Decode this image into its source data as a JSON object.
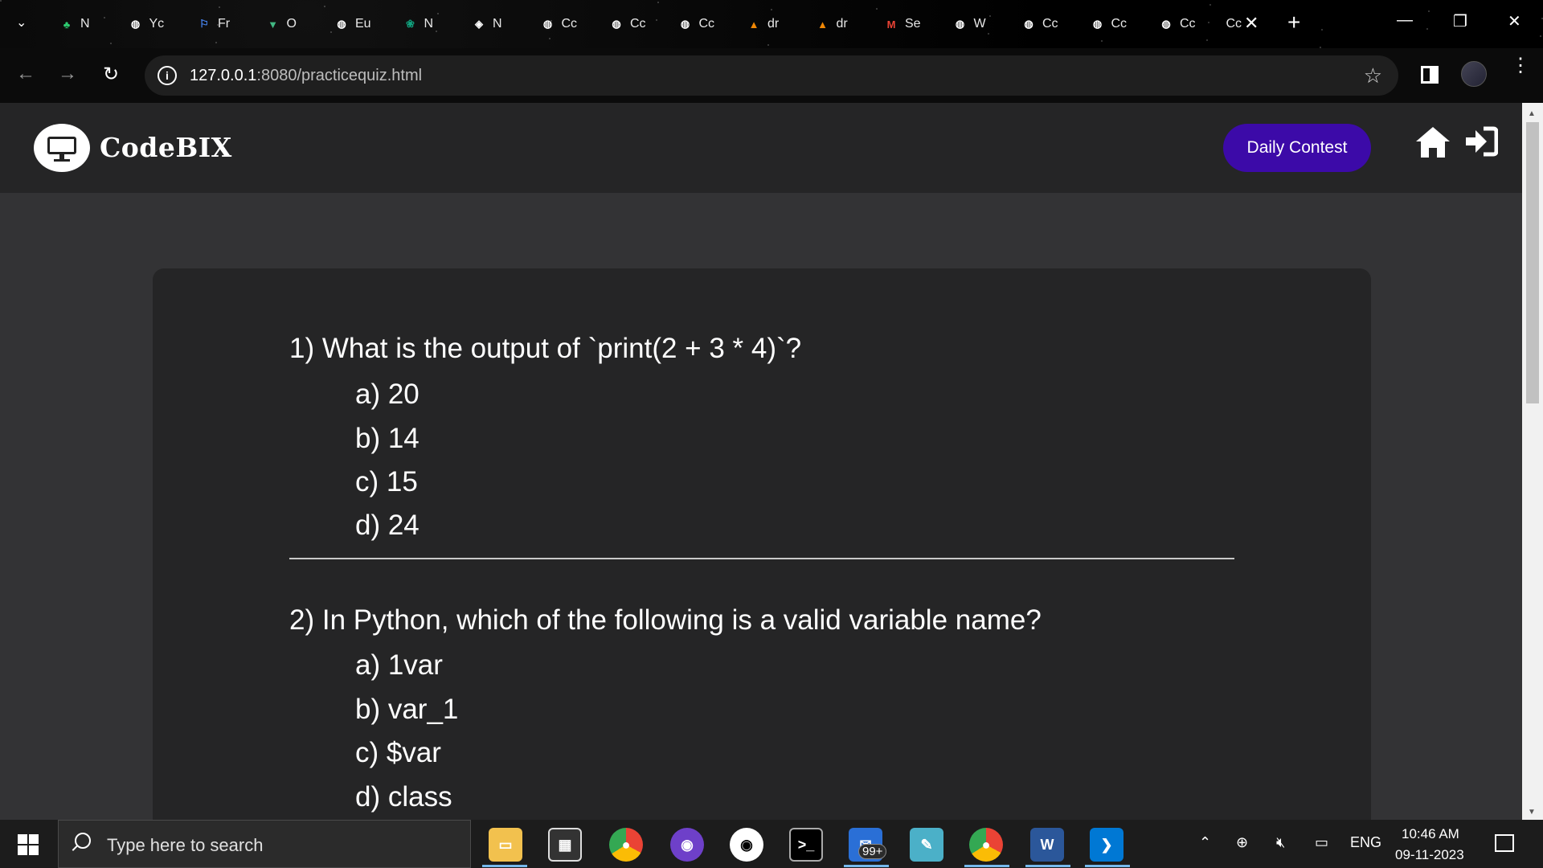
{
  "browser": {
    "tabs": [
      {
        "label": "N",
        "icon": "leaf-icon",
        "color": "#2ecc71"
      },
      {
        "label": "Yc",
        "icon": "globe-icon",
        "color": "#ffffff"
      },
      {
        "label": "Fr",
        "icon": "flag-icon",
        "color": "#4a8cff"
      },
      {
        "label": "O",
        "icon": "vue-icon",
        "color": "#41b883"
      },
      {
        "label": "Eu",
        "icon": "globe-icon",
        "color": "#ffffff"
      },
      {
        "label": "N",
        "icon": "chatgpt-icon",
        "color": "#10a37f"
      },
      {
        "label": "N",
        "icon": "shield-icon",
        "color": "#ffffff"
      },
      {
        "label": "Cc",
        "icon": "globe-icon",
        "color": "#ffffff"
      },
      {
        "label": "Cc",
        "icon": "globe-icon",
        "color": "#ffffff"
      },
      {
        "label": "Cc",
        "icon": "globe-icon",
        "color": "#ffffff"
      },
      {
        "label": "dr",
        "icon": "drawio-icon",
        "color": "#f08705"
      },
      {
        "label": "dr",
        "icon": "drawio-icon",
        "color": "#f08705"
      },
      {
        "label": "Se",
        "icon": "gmail-icon",
        "color": "#ea4335"
      },
      {
        "label": "W",
        "icon": "globe-icon",
        "color": "#ffffff"
      },
      {
        "label": "Cc",
        "icon": "globe-icon",
        "color": "#ffffff"
      },
      {
        "label": "Cc",
        "icon": "globe-icon",
        "color": "#ffffff"
      },
      {
        "label": "Cc",
        "icon": "globe-icon",
        "color": "#ffffff"
      },
      {
        "label": "Cc",
        "icon": "none",
        "color": "#ffffff"
      }
    ],
    "tab_close": "✕",
    "new_tab": "+",
    "url_host": "127.0.0.1",
    "url_rest": ":8080/practicequiz.html"
  },
  "site": {
    "brand": "CodeBIX",
    "contest_label": "Daily Contest",
    "accent": "#3c0aa8"
  },
  "quiz": {
    "questions": [
      {
        "text": "1) What is the output of `print(2 + 3 * 4)`?",
        "options": [
          "a) 20",
          "b) 14",
          "c) 15",
          "d) 24"
        ]
      },
      {
        "text": "2) In Python, which of the following is a valid variable name?",
        "options": [
          "a) 1var",
          "b) var_1",
          "c) $var",
          "d) class"
        ]
      }
    ]
  },
  "taskbar": {
    "search_placeholder": "Type here to search",
    "mail_badge": "99+",
    "language": "ENG",
    "time": "10:46 AM",
    "date": "09-11-2023"
  }
}
